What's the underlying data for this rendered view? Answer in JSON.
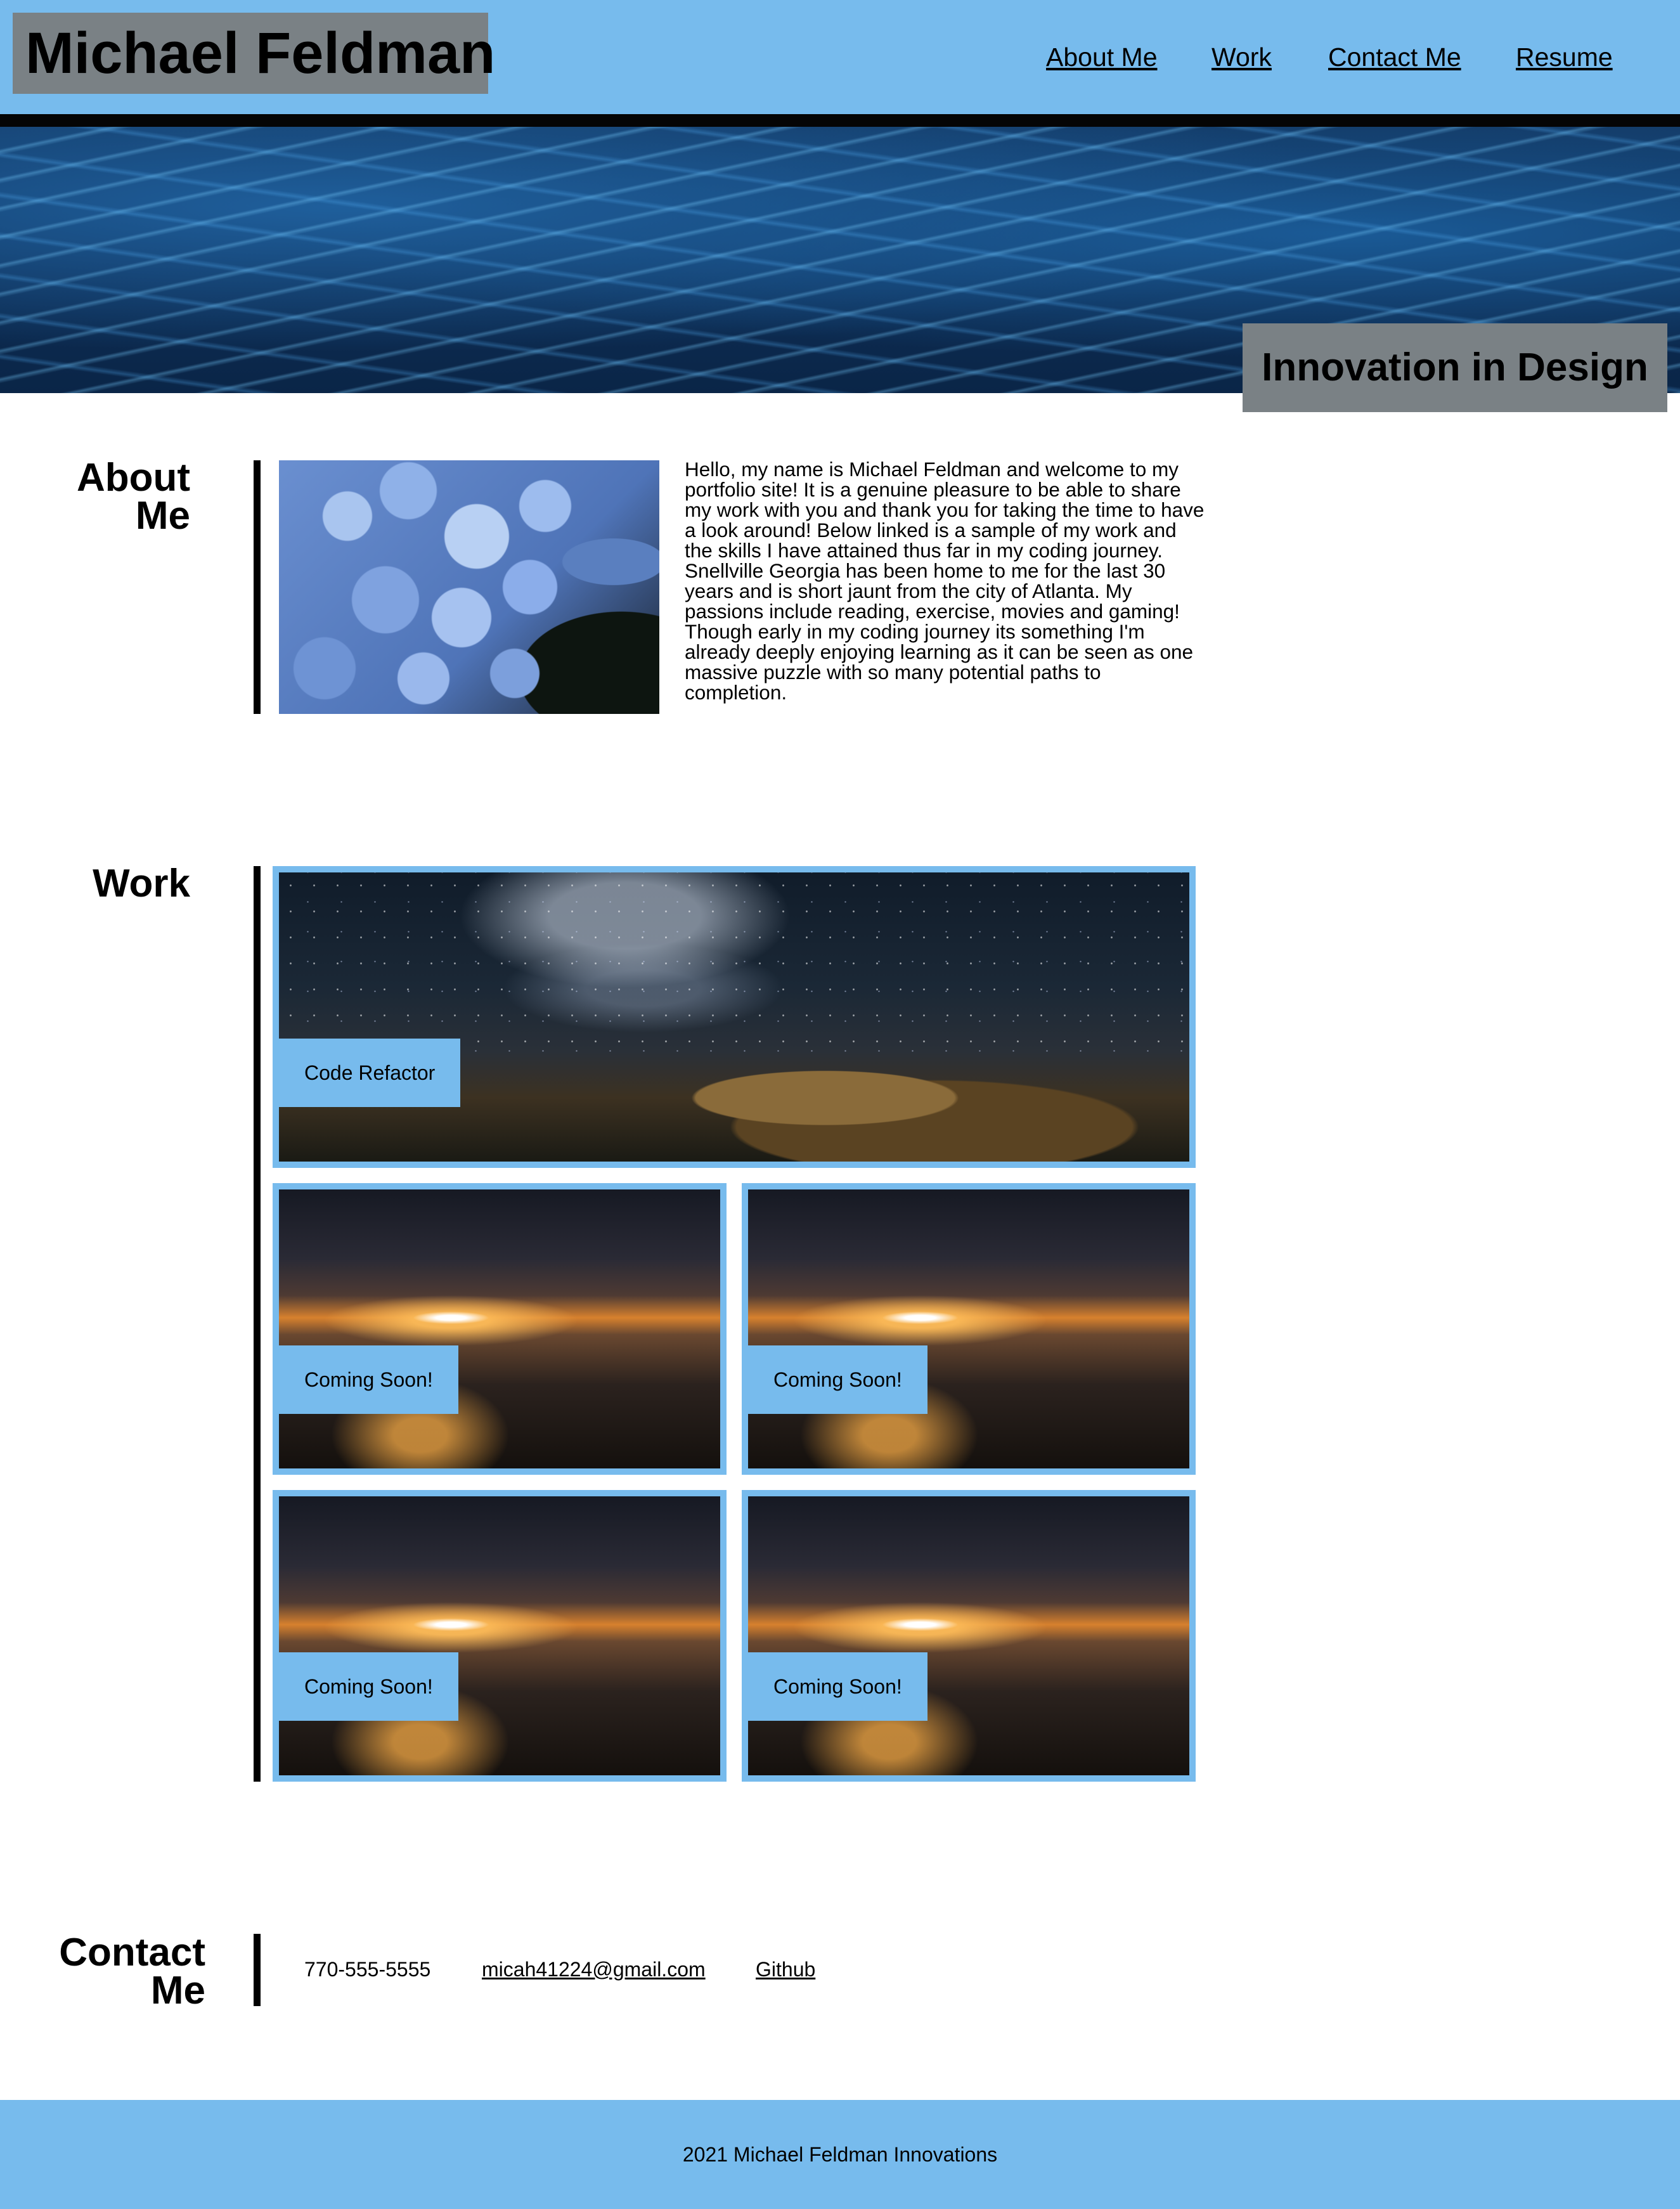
{
  "header": {
    "site_title": "Michael Feldman",
    "nav": [
      "About Me",
      "Work",
      "Contact Me",
      "Resume"
    ]
  },
  "hero": {
    "tagline": "Innovation in Design"
  },
  "about": {
    "heading_line1": "About",
    "heading_line2": "Me",
    "text": "Hello, my name is Michael Feldman and welcome to my portfolio site! It is a genuine pleasure to be able to share my work with you and thank you for taking the time to have a look around! Below linked is a sample of my work and the skills I have attained thus far in my coding journey. Snellville Georgia has been home to me for the last 30 years and is short jaunt from the city of Atlanta. My passions include reading, exercise, movies and gaming! Though early in my coding journey its something I'm already deeply enjoying learning as it can be seen as one massive puzzle with so many potential paths to completion."
  },
  "work": {
    "heading": "Work",
    "projects": [
      {
        "label": "Code Refactor"
      },
      {
        "label": "Coming Soon!"
      },
      {
        "label": "Coming Soon!"
      },
      {
        "label": "Coming Soon!"
      },
      {
        "label": "Coming Soon!"
      }
    ]
  },
  "contact": {
    "heading_line1": "Contact",
    "heading_line2": "Me",
    "phone": "770-555-5555",
    "email": "micah41224@gmail.com",
    "github": "Github"
  },
  "footer": {
    "text": "2021 Michael Feldman Innovations"
  },
  "colors": {
    "accent_blue": "#77bbed",
    "title_gray": "#7a8185",
    "rule_black": "#000000"
  }
}
